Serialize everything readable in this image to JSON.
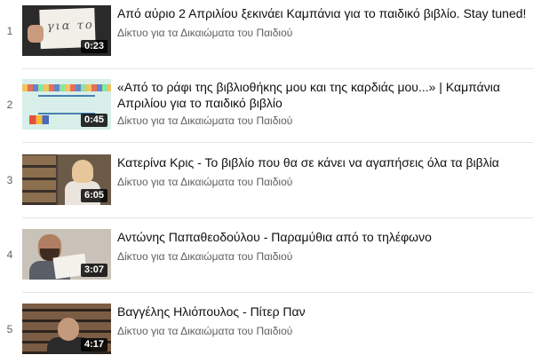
{
  "playlist": {
    "items": [
      {
        "index": "1",
        "title": "Από αύριο 2 Απριλίου ξεκινάει Καμπάνια για το παιδικό βιβλίο. Stay tuned!",
        "channel": "Δίκτυο για τα Δικαιώματα του Παιδιού",
        "duration": "0:23"
      },
      {
        "index": "2",
        "title": "«Από το ράφι της βιβλιοθήκης μου και της καρδιάς μου...» | Καμπάνια Απριλίου για το παιδικό βιβλίο",
        "channel": "Δίκτυο για τα Δικαιώματα του Παιδιού",
        "duration": "0:45"
      },
      {
        "index": "3",
        "title": "Κατερίνα Κρις - Το βιβλίο που θα σε κάνει να αγαπήσεις όλα τα βιβλία",
        "channel": "Δίκτυο για τα Δικαιώματα του Παιδιού",
        "duration": "6:05"
      },
      {
        "index": "4",
        "title": "Αντώνης Παπαθεοδούλου - Παραμύθια από το τηλέφωνο",
        "channel": "Δίκτυο για τα Δικαιώματα του Παιδιού",
        "duration": "3:07"
      },
      {
        "index": "5",
        "title": "Βαγγέλης Ηλιόπουλος - Πίτερ Παν",
        "channel": "Δίκτυο για τα Δικαιώματα του Παιδιού",
        "duration": "4:17"
      }
    ]
  }
}
